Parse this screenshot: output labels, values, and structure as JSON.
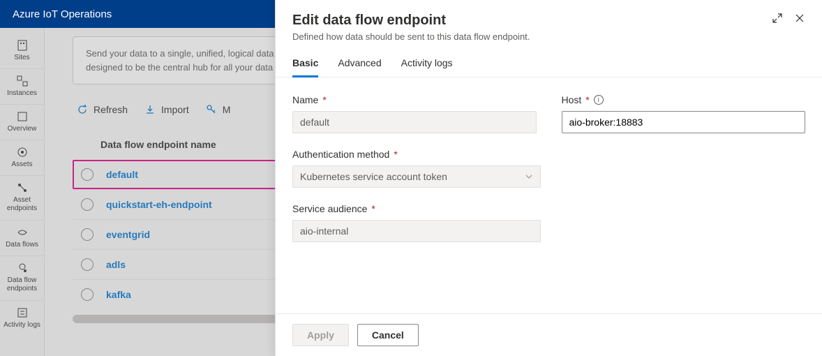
{
  "app_title": "Azure IoT Operations",
  "sidebar": {
    "items": [
      {
        "label": "Sites",
        "icon": "sites"
      },
      {
        "label": "Instances",
        "icon": "instances"
      },
      {
        "label": "Overview",
        "icon": "overview"
      },
      {
        "label": "Assets",
        "icon": "assets"
      },
      {
        "label": "Asset endpoints",
        "icon": "asset-endpoints"
      },
      {
        "label": "Data flows",
        "icon": "dataflows"
      },
      {
        "label": "Data flow endpoints",
        "icon": "dataflow-endpoints"
      },
      {
        "label": "Activity logs",
        "icon": "activity-logs"
      }
    ]
  },
  "info_card": {
    "line1": "Send your data to a single, unified, logical data",
    "line2": "designed to be the central hub for all your data"
  },
  "toolbar": {
    "refresh": "Refresh",
    "import": "Import",
    "manage_truncated": "M"
  },
  "table": {
    "col_name": "Data flow endpoint name",
    "rows": [
      {
        "name": "default",
        "highlighted": true
      },
      {
        "name": "quickstart-eh-endpoint",
        "highlighted": false
      },
      {
        "name": "eventgrid",
        "highlighted": false
      },
      {
        "name": "adls",
        "highlighted": false
      },
      {
        "name": "kafka",
        "highlighted": false
      }
    ]
  },
  "panel": {
    "title": "Edit data flow endpoint",
    "subtitle": "Defined how data should be sent to this data flow endpoint.",
    "tabs": [
      {
        "label": "Basic",
        "active": true
      },
      {
        "label": "Advanced",
        "active": false
      },
      {
        "label": "Activity logs",
        "active": false
      }
    ],
    "form": {
      "name_label": "Name",
      "name_value": "default",
      "host_label": "Host",
      "host_value": "aio-broker:18883",
      "auth_label": "Authentication method",
      "auth_value": "Kubernetes service account token",
      "audience_label": "Service audience",
      "audience_value": "aio-internal"
    },
    "footer": {
      "apply": "Apply",
      "cancel": "Cancel"
    }
  }
}
